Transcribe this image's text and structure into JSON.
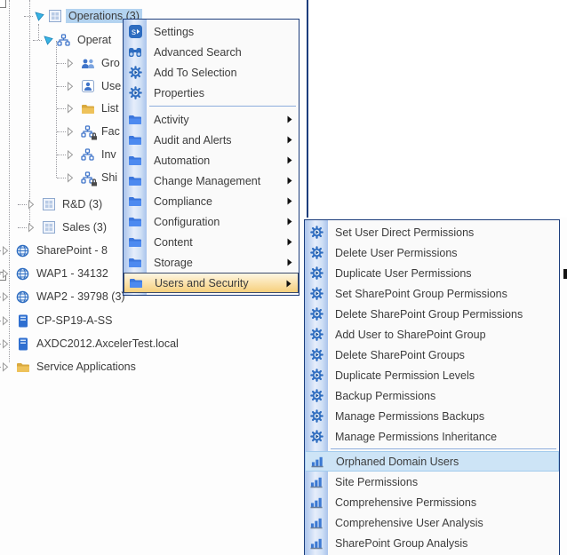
{
  "colors": {
    "menu_border": "#1c3d7c",
    "icon_strip_blue": "#aac4ec",
    "category_highlight_top": "#fdf6e4",
    "category_highlight_bottom": "#f6cf7d",
    "submenu_highlight_bg": "#cde4f6",
    "tree_selection_bg": "#b3d3f0",
    "icon_blue": "#2d6cc0",
    "tree_folder_yellow": "#eec25a"
  },
  "tree": {
    "items": [
      {
        "label": "Operations (3)",
        "icon": "site-collection",
        "expanded": true,
        "selected": true
      },
      {
        "label": "Operat",
        "icon": "sites",
        "expanded": true,
        "truncated": true
      },
      {
        "label": "Gro",
        "icon": "groups",
        "expanded": false,
        "truncated": true
      },
      {
        "label": "Use",
        "icon": "users",
        "expanded": false,
        "truncated": true
      },
      {
        "label": "List",
        "icon": "folder",
        "expanded": false,
        "truncated": true
      },
      {
        "label": "Fac",
        "icon": "sites-lock",
        "expanded": false,
        "truncated": true
      },
      {
        "label": "Inv",
        "icon": "sites",
        "expanded": false,
        "truncated": true
      },
      {
        "label": "Shi",
        "icon": "sites-lock",
        "expanded": false,
        "truncated": true
      },
      {
        "label": "R&D (3)",
        "icon": "site-collection",
        "expanded": false
      },
      {
        "label": "Sales (3)",
        "icon": "site-collection",
        "expanded": false
      },
      {
        "label": "SharePoint - 8",
        "icon": "globe",
        "expanded": false,
        "truncated": true
      },
      {
        "label": "WAP1 - 34132",
        "icon": "globe",
        "expanded": false,
        "truncated": true
      },
      {
        "label": "WAP2 - 39798 (3)",
        "icon": "globe",
        "expanded": false
      },
      {
        "label": "CP-SP19-A-SS",
        "icon": "server",
        "expanded": false
      },
      {
        "label": "AXDC2012.AxcelerTest.local",
        "icon": "server",
        "expanded": false
      },
      {
        "label": "Service Applications",
        "icon": "folder",
        "expanded": false
      }
    ]
  },
  "context_menu": {
    "action_items": [
      {
        "label": "Settings",
        "icon": "sharepoint-settings"
      },
      {
        "label": "Advanced Search",
        "icon": "binoculars"
      },
      {
        "label": "Add To Selection",
        "icon": "gear-run"
      },
      {
        "label": "Properties",
        "icon": "gear-run"
      }
    ],
    "category_items": [
      {
        "label": "Activity",
        "icon": "blue-folder",
        "has_submenu": true
      },
      {
        "label": "Audit and Alerts",
        "icon": "blue-folder",
        "has_submenu": true
      },
      {
        "label": "Automation",
        "icon": "blue-folder",
        "has_submenu": true
      },
      {
        "label": "Change Management",
        "icon": "blue-folder",
        "has_submenu": true
      },
      {
        "label": "Compliance",
        "icon": "blue-folder",
        "has_submenu": true
      },
      {
        "label": "Configuration",
        "icon": "blue-folder",
        "has_submenu": true
      },
      {
        "label": "Content",
        "icon": "blue-folder",
        "has_submenu": true
      },
      {
        "label": "Storage",
        "icon": "blue-folder",
        "has_submenu": true
      },
      {
        "label": "Users and Security",
        "icon": "blue-folder",
        "has_submenu": true,
        "highlighted": true
      }
    ]
  },
  "submenu": {
    "action_items": [
      {
        "label": "Set User Direct Permissions",
        "icon": "gear-run"
      },
      {
        "label": "Delete User Permissions",
        "icon": "gear-run"
      },
      {
        "label": "Duplicate User Permissions",
        "icon": "gear-run"
      },
      {
        "label": "Set SharePoint Group Permissions",
        "icon": "gear-run"
      },
      {
        "label": "Delete SharePoint Group Permissions",
        "icon": "gear-run"
      },
      {
        "label": "Add User to SharePoint Group",
        "icon": "gear-run"
      },
      {
        "label": "Delete SharePoint Groups",
        "icon": "gear-run"
      },
      {
        "label": "Duplicate Permission Levels",
        "icon": "gear-run"
      },
      {
        "label": "Backup Permissions",
        "icon": "gear-run"
      },
      {
        "label": "Manage Permissions Backups",
        "icon": "gear-run"
      },
      {
        "label": "Manage Permissions Inheritance",
        "icon": "gear-run"
      }
    ],
    "report_items": [
      {
        "label": "Orphaned Domain Users",
        "icon": "bar-chart",
        "highlighted": true
      },
      {
        "label": "Site Permissions",
        "icon": "bar-chart"
      },
      {
        "label": "Comprehensive Permissions",
        "icon": "bar-chart"
      },
      {
        "label": "Comprehensive User Analysis",
        "icon": "bar-chart"
      },
      {
        "label": "SharePoint Group Analysis",
        "icon": "bar-chart"
      }
    ]
  }
}
